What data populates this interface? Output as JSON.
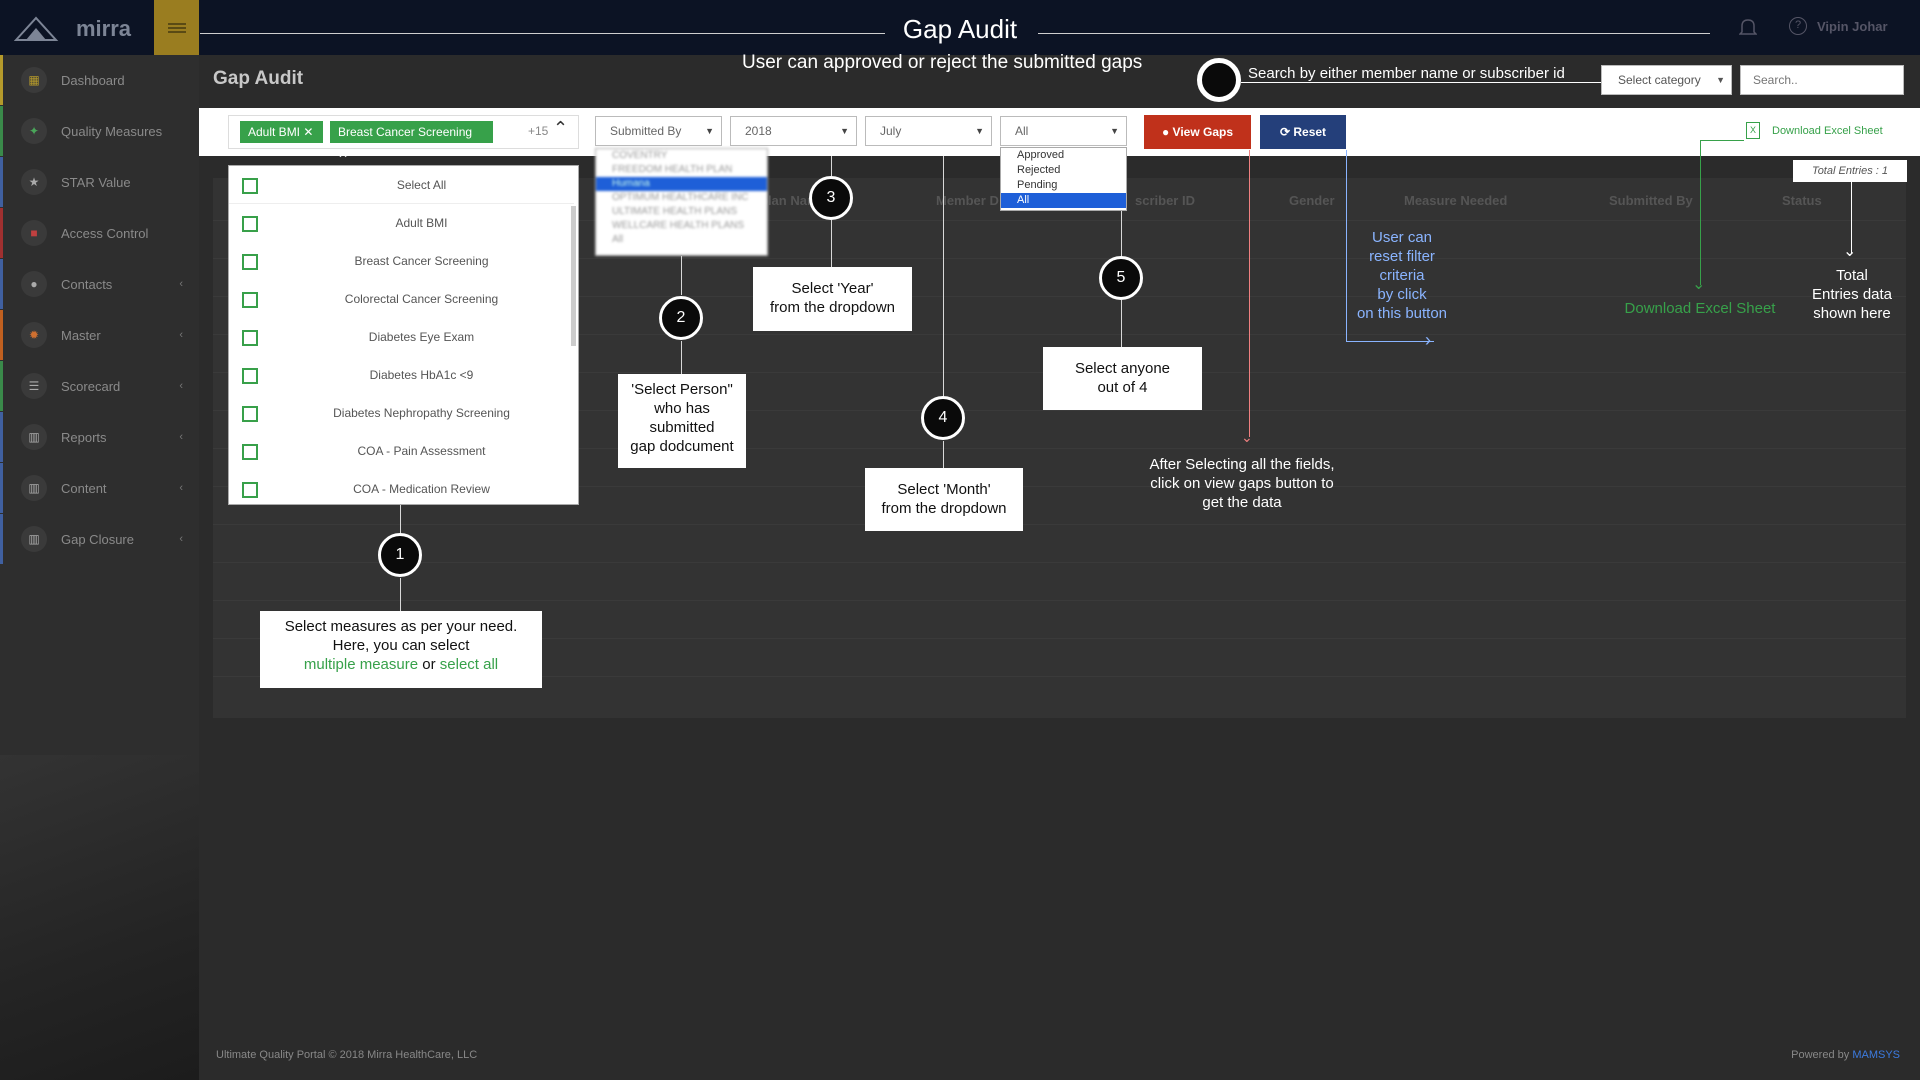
{
  "header": {
    "title": "Gap Audit",
    "subtitle": "User can approved or reject the submitted gaps",
    "search_hint": "Search by either member name or subscriber id",
    "user_name": "Vipin Johar",
    "logo_text": "mirra"
  },
  "sidebar": {
    "items": [
      {
        "label": "Dashboard",
        "icon": "dashboard-icon",
        "has_arrow": false
      },
      {
        "label": "Quality Measures",
        "icon": "quality-icon",
        "has_arrow": false
      },
      {
        "label": "STAR Value",
        "icon": "star-icon",
        "has_arrow": false
      },
      {
        "label": "Access Control",
        "icon": "lock-icon",
        "has_arrow": false
      },
      {
        "label": "Contacts",
        "icon": "contact-icon",
        "has_arrow": true
      },
      {
        "label": "Master",
        "icon": "gear-icon",
        "has_arrow": true
      },
      {
        "label": "Scorecard",
        "icon": "list-icon",
        "has_arrow": true
      },
      {
        "label": "Reports",
        "icon": "bar-chart-icon",
        "has_arrow": true
      },
      {
        "label": "Content",
        "icon": "bar-chart-icon",
        "has_arrow": true
      },
      {
        "label": "Gap Closure",
        "icon": "bar-chart-icon",
        "has_arrow": true
      }
    ]
  },
  "page": {
    "title": "Gap Audit",
    "category_placeholder": "Select category",
    "search_placeholder": "Search.."
  },
  "filters": {
    "tags": [
      "Adult BMI",
      "Breast Cancer Screening"
    ],
    "more_count": "+15",
    "submitted_by": "Submitted By",
    "year": "2018",
    "month": "July",
    "status": "All",
    "view_gaps": "View Gaps",
    "reset": "Reset",
    "download": "Download Excel Sheet",
    "total_entries": "Total Entries : 1"
  },
  "measures_dropdown": [
    "Select All",
    "Adult BMI",
    "Breast Cancer Screening",
    "Colorectal Cancer Screening",
    "Diabetes Eye Exam",
    "Diabetes HbA1c <9",
    "Diabetes Nephropathy Screening",
    "COA - Pain Assessment",
    "COA - Medication Review"
  ],
  "submitted_by_options": [
    "COVENTRY",
    "FREEDOM HEALTH PLAN",
    "Humana",
    "OPTIMUM HEALTHCARE INC",
    "ULTIMATE HEALTH PLANS",
    "WELLCARE HEALTH PLANS",
    "All"
  ],
  "status_options": [
    "Approved",
    "Rejected",
    "Pending",
    "All"
  ],
  "table": {
    "headers": [
      "plan Name",
      "Member D",
      "scriber ID",
      "Gender",
      "Measure Needed",
      "Submitted By",
      "Status"
    ]
  },
  "annotations": {
    "step1_num": "1",
    "step1_a": "Select measures as per your need.",
    "step1_b": "Here, you can select",
    "step1_c1": "multiple measure",
    "step1_c2": " or ",
    "step1_c3": "select all",
    "step2_num": "2",
    "step2": [
      "'Select Person\"",
      "who has",
      "submitted",
      "gap dodcument"
    ],
    "step3_num": "3",
    "step3": [
      "Select  'Year'",
      "from the dropdown"
    ],
    "step4_num": "4",
    "step4": [
      "Select  'Month'",
      "from the dropdown"
    ],
    "step5_num": "5",
    "step5": [
      "Select anyone",
      "out of 4"
    ],
    "view_note": [
      "After Selecting all the fields,",
      "click on view gaps button to",
      "get the data"
    ],
    "reset_note": [
      "User can",
      "reset filter",
      "criteria",
      "by click",
      "on this button"
    ],
    "download_note": "Download Excel Sheet",
    "total_note": [
      "Total",
      "Entries data",
      "shown here"
    ]
  },
  "footer": {
    "copyright": "Ultimate Quality Portal © 2018 Mirra HealthCare, LLC",
    "powered_prefix": "Powered by ",
    "powered_brand": "MAMSYS"
  },
  "colors": {
    "green": "#37a14a",
    "red": "#c0311b",
    "navy": "#243f7a",
    "blue_note": "#8ab4ff"
  }
}
